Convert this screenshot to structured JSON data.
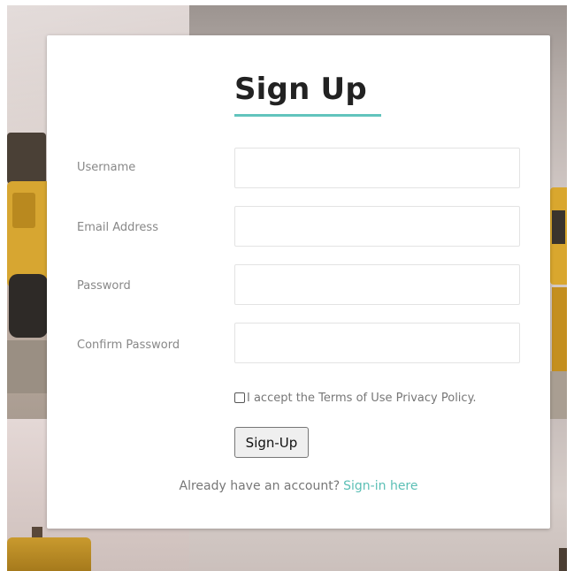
{
  "form": {
    "title": "Sign Up",
    "fields": [
      {
        "label": "Username",
        "value": "",
        "placeholder": ""
      },
      {
        "label": "Email Address",
        "value": "",
        "placeholder": ""
      },
      {
        "label": "Password",
        "value": "",
        "placeholder": ""
      },
      {
        "label": "Confirm Password",
        "value": "",
        "placeholder": ""
      }
    ],
    "terms_label": "I accept the Terms of Use Privacy Policy.",
    "terms_checked": false,
    "submit_label": "Sign-Up",
    "signin_prompt": "Already have an account?",
    "signin_link": "Sign-in here"
  },
  "colors": {
    "accent": "#62c4bd",
    "link": "#5bbfb5",
    "card_background": "#ffffff",
    "label_text": "#888888"
  }
}
